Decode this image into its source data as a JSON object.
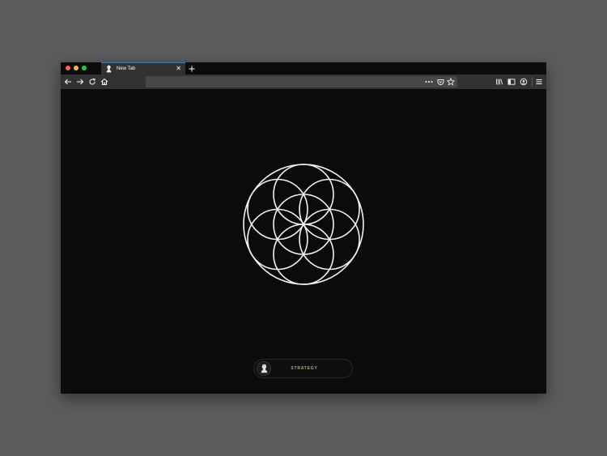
{
  "browser": {
    "tab": {
      "title": "New Tab",
      "favicon": "bust-icon"
    },
    "urlbar": {
      "value": "",
      "placeholder": ""
    },
    "accent_color": "#0a84ff"
  },
  "page": {
    "logo": "seed-of-life-icon",
    "badge": {
      "label": "STRATEGY",
      "icon": "bust-icon",
      "label_color": "#b8a77c"
    },
    "background_color": "#0b0b0b"
  }
}
